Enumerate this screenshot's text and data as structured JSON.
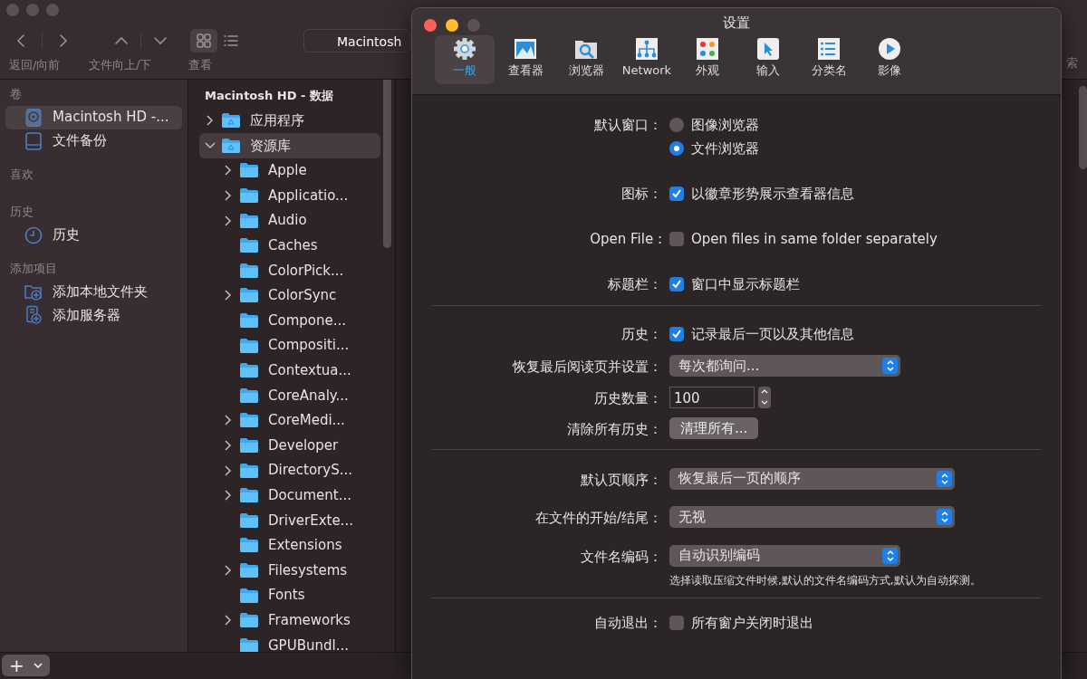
{
  "finder": {
    "toolbar": {
      "path_field": "Macintosh",
      "groups": [
        {
          "label": "返回/向前"
        },
        {
          "label": "文件向上/下"
        },
        {
          "label": "查看"
        }
      ],
      "search_label": "索"
    },
    "sidebar": [
      {
        "heading": "卷",
        "items": [
          {
            "label": "Macintosh HD -...",
            "selected": true
          },
          {
            "label": "文件备份",
            "selected": false
          }
        ]
      },
      {
        "heading": "喜欢"
      },
      {
        "heading": "历史",
        "items": [
          {
            "label": "历史",
            "selected": false
          }
        ]
      },
      {
        "heading": "添加项目",
        "items": [
          {
            "label": "添加本地文件夹",
            "selected": false
          },
          {
            "label": "添加服务器",
            "selected": false
          }
        ]
      }
    ],
    "column": {
      "title": "Macintosh HD - 数据",
      "items": [
        {
          "label": "应用程序",
          "expanded": false,
          "selected": false
        },
        {
          "label": "资源库",
          "expanded": true,
          "selected": true,
          "children": [
            {
              "label": "Apple",
              "expandable": true
            },
            {
              "label": "Applicatio...",
              "expandable": true
            },
            {
              "label": "Audio",
              "expandable": true
            },
            {
              "label": "Caches",
              "expandable": false
            },
            {
              "label": "ColorPick...",
              "expandable": false
            },
            {
              "label": "ColorSync",
              "expandable": true
            },
            {
              "label": "Compone...",
              "expandable": false
            },
            {
              "label": "Compositi...",
              "expandable": false
            },
            {
              "label": "Contextua...",
              "expandable": false
            },
            {
              "label": "CoreAnaly...",
              "expandable": false
            },
            {
              "label": "CoreMedi...",
              "expandable": true
            },
            {
              "label": "Developer",
              "expandable": true
            },
            {
              "label": "DirectoryS...",
              "expandable": true
            },
            {
              "label": "Document...",
              "expandable": true
            },
            {
              "label": "DriverExte...",
              "expandable": false
            },
            {
              "label": "Extensions",
              "expandable": false
            },
            {
              "label": "Filesystems",
              "expandable": true
            },
            {
              "label": "Fonts",
              "expandable": false
            },
            {
              "label": "Frameworks",
              "expandable": true
            },
            {
              "label": "GPUBundl...",
              "expandable": false
            }
          ]
        }
      ]
    },
    "bottom_bar": {
      "add_button": "+"
    }
  },
  "settings": {
    "window": {
      "title": "设置"
    },
    "tabs": [
      {
        "label": "一般",
        "selected": true
      },
      {
        "label": "查看器",
        "selected": false
      },
      {
        "label": "浏览器",
        "selected": false
      },
      {
        "label": "Network",
        "selected": false
      },
      {
        "label": "外观",
        "selected": false
      },
      {
        "label": "输入",
        "selected": false
      },
      {
        "label": "分类名",
        "selected": false
      },
      {
        "label": "影像",
        "selected": false
      }
    ],
    "sections": [
      {
        "rows": [
          {
            "kind": "radio",
            "label": "默认窗口：",
            "options": [
              {
                "text": "图像浏览器",
                "selected": false
              },
              {
                "text": "文件浏览器",
                "selected": true
              }
            ]
          },
          {
            "kind": "checkbox",
            "label": "图标：",
            "text": "以徽章形势展示查看器信息",
            "checked": true
          },
          {
            "kind": "checkbox",
            "label": "Open File :",
            "text": "Open files in same folder separately",
            "checked": false
          },
          {
            "kind": "checkbox",
            "label": "标题栏：",
            "text": "窗口中显示标题栏",
            "checked": true
          }
        ]
      },
      {
        "rows": [
          {
            "kind": "checkbox",
            "label": "历史：",
            "text": "记录最后一页以及其他信息",
            "checked": true
          },
          {
            "kind": "select",
            "label": "恢复最后阅读页并设置：",
            "value": "每次都询问...",
            "wide": false
          },
          {
            "kind": "stepper",
            "label": "历史数量：",
            "value": "100"
          },
          {
            "kind": "button",
            "label": "清除所有历史：",
            "text": "清理所有..."
          }
        ]
      },
      {
        "rows": [
          {
            "kind": "select",
            "label": "默认页顺序：",
            "value": "恢复最后一页的顺序",
            "wide": true
          },
          {
            "kind": "select",
            "label": "在文件的开始/结尾：",
            "value": "无视",
            "wide": true
          },
          {
            "kind": "select",
            "label": "文件名编码：",
            "value": "自动识别编码",
            "wide": false,
            "note": "选择读取压缩文件时候,默认的文件名编码方式,默认为自动探测。"
          }
        ]
      },
      {
        "rows": [
          {
            "kind": "checkbox",
            "label": "自动退出：",
            "text": "所有窗户关闭时退出",
            "checked": false
          }
        ]
      }
    ]
  }
}
